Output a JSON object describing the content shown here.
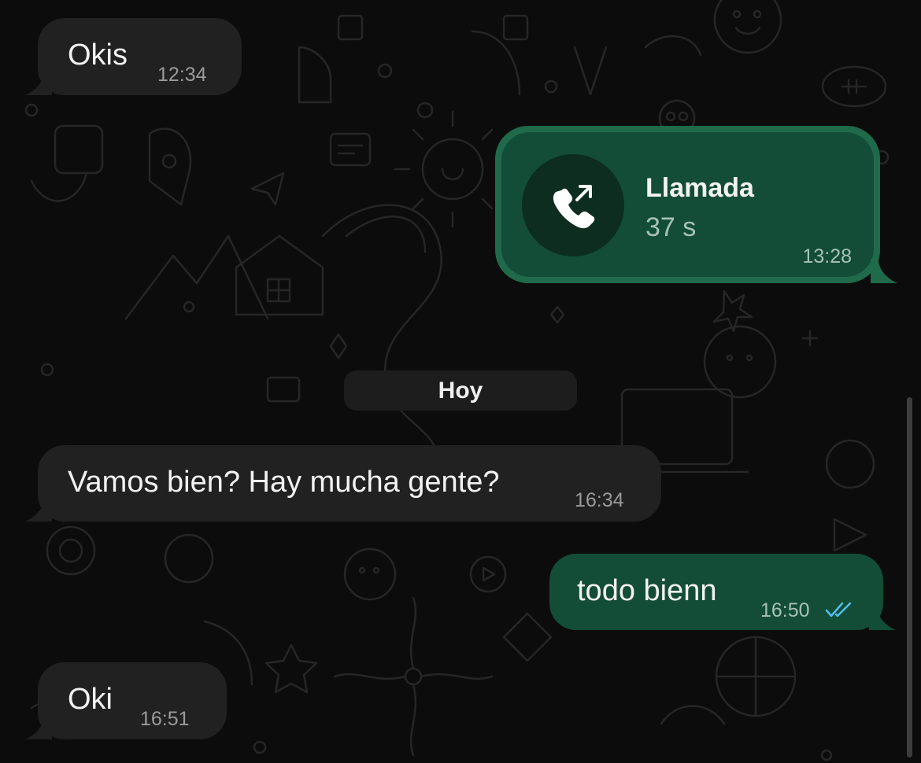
{
  "colors": {
    "background": "#0c0c0c",
    "incoming_bubble": "#212121",
    "outgoing_bubble": "#134d37",
    "call_border": "#1f6a4b",
    "read_checks": "#53bdeb"
  },
  "messages": [
    {
      "direction": "incoming",
      "text": "Okis",
      "time": "12:34"
    },
    {
      "direction": "outgoing",
      "type": "call",
      "title": "Llamada",
      "duration": "37 s",
      "time": "13:28",
      "icon": "outgoing-call-icon"
    },
    {
      "direction": "incoming",
      "text": "Vamos bien? Hay mucha gente?",
      "time": "16:34"
    },
    {
      "direction": "outgoing",
      "text": "todo bienn",
      "time": "16:50",
      "status_icon": "double-check-read-icon"
    },
    {
      "direction": "incoming",
      "text": "Oki",
      "time": "16:51"
    }
  ],
  "date_separator": "Hoy"
}
